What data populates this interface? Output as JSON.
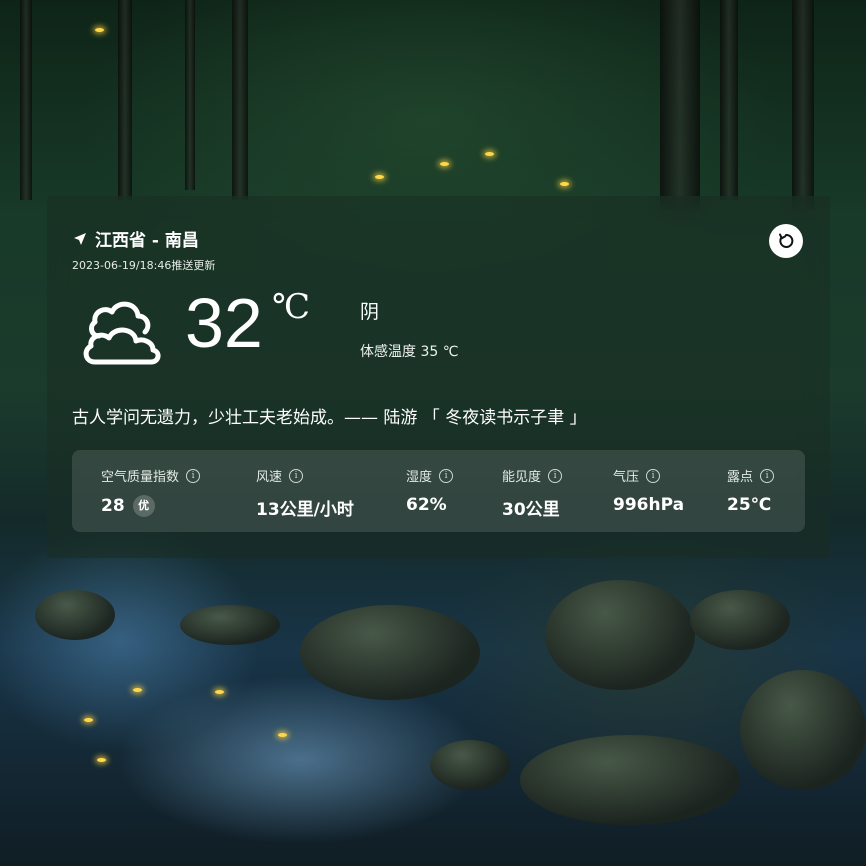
{
  "location": {
    "label": "江西省 - 南昌",
    "icon": "location-arrow-icon"
  },
  "update_time": "2023-06-19/18:46推送更新",
  "refresh": {
    "icon": "refresh-icon"
  },
  "current": {
    "icon": "cloudy-icon",
    "temperature": "32",
    "unit": "℃",
    "condition": "阴",
    "feels_like": "体感温度 35 ℃"
  },
  "quote": "古人学问无遗力，少壮工夫老始成。—— 陆游 「 冬夜读书示子聿 」",
  "stats": [
    {
      "label": "空气质量指数",
      "value": "28",
      "badge": "优"
    },
    {
      "label": "风速",
      "value": "13公里/小时"
    },
    {
      "label": "湿度",
      "value": "62%"
    },
    {
      "label": "能见度",
      "value": "30公里"
    },
    {
      "label": "气压",
      "value": "996hPa"
    },
    {
      "label": "露点",
      "value": "25℃"
    }
  ],
  "info_glyph": "i"
}
